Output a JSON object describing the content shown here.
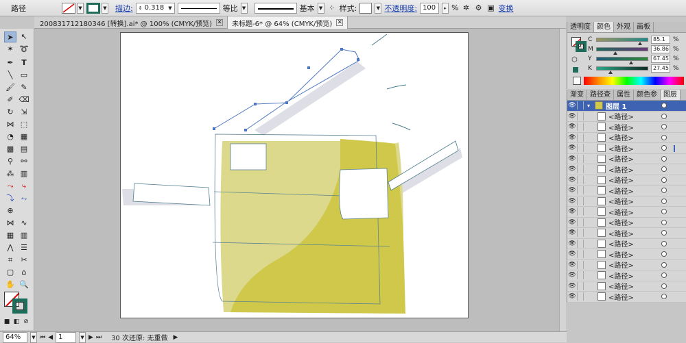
{
  "control_bar": {
    "selection_label": "路径",
    "stroke_label": "描边:",
    "stroke_weight": "0.318",
    "stroke_profile_label": "等比",
    "brush_label": "基本",
    "style_label": "样式:",
    "opacity_label": "不透明度:",
    "opacity_value": "100",
    "percent": "%",
    "transform_label": "变换"
  },
  "document_tabs": [
    {
      "label": "20083171218034​6 [转换].ai* @ 100% (CMYK/预览)"
    },
    {
      "label": "未标题-6* @ 64% (CMYK/预览)"
    }
  ],
  "color_panel": {
    "tabs": [
      "透明度",
      "颜色",
      "外观",
      "画板"
    ],
    "active_tab": "颜色",
    "channels": [
      {
        "name": "C",
        "value": "85.1",
        "thumb": 0.851
      },
      {
        "name": "M",
        "value": "36.86",
        "thumb": 0.3686
      },
      {
        "name": "Y",
        "value": "67.45",
        "thumb": 0.6745
      },
      {
        "name": "K",
        "value": "27.45",
        "thumb": 0.2745
      }
    ],
    "percent": "%"
  },
  "layers_panel": {
    "tabs": [
      "渐变",
      "路径查",
      "属性",
      "颜色参",
      "图层"
    ],
    "active_tab": "图层",
    "layer_name": "图层 1",
    "items": [
      "<路径>",
      "<路径>",
      "<路径>",
      "<路径>",
      "<路径>",
      "<路径>",
      "<路径>",
      "<路径>",
      "<路径>",
      "<路径>",
      "<路径>",
      "<路径>",
      "<路径>",
      "<路径>",
      "<路径>",
      "<路径>",
      "<路径>",
      "<路径>"
    ]
  },
  "status_bar": {
    "zoom": "64%",
    "artboard_number": "1",
    "message": "30 次还原: 无重做"
  },
  "colors": {
    "stroke_fill": "#1e6c5a",
    "olive_dark": "#cfc84a",
    "olive_light": "#dcd98c",
    "path_blue": "#4d77c2"
  }
}
